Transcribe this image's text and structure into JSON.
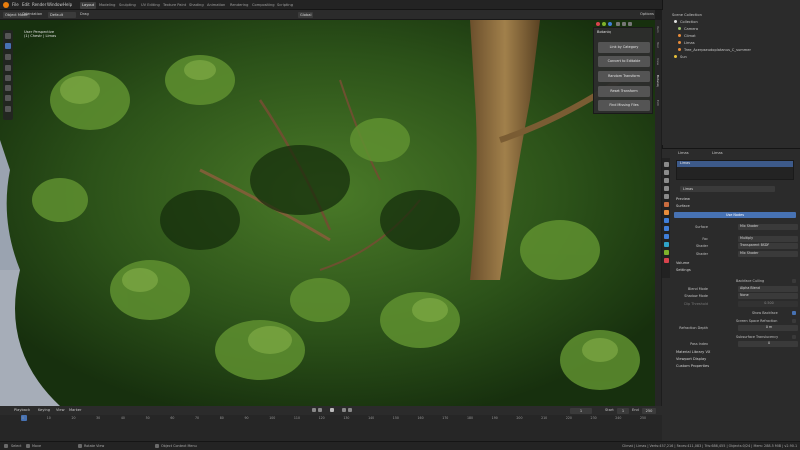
{
  "menu": [
    "File",
    "Edit",
    "Render",
    "Window",
    "Help"
  ],
  "workspaces": [
    "Layout",
    "Modeling",
    "Sculpting",
    "UV Editing",
    "Texture Paint",
    "Shading",
    "Animation",
    "Rendering",
    "Compositing",
    "Scripting"
  ],
  "top_right": {
    "scene": "Scene",
    "view_layer": "View Layer"
  },
  "viewport_header": {
    "mode": "Object Mode",
    "view": "View",
    "select": "Select",
    "add": "Add",
    "object": "Object",
    "transform": "Global",
    "orientation": "Orientation",
    "orientation_value": "Default",
    "drag": "Drag",
    "drag_value": "Select Box",
    "options": "Options"
  },
  "viewport_overlay": {
    "line1": "User Perspective",
    "line2": "(1) Chestr | Limas"
  },
  "npanel": {
    "title": "Botaniq",
    "buttons": [
      "Link by Category",
      "Convert to Editable",
      "Random Transform",
      "Reset Transform",
      "Find Missing Files"
    ]
  },
  "side_tabs": [
    "Item",
    "Tool",
    "View",
    "Botaniq",
    "Edit"
  ],
  "outliner": {
    "header": "Scene Collection",
    "rows": [
      "Collection",
      "Camera",
      "Climat",
      "Limas",
      "Tree_Acerpseudoplatanus_C_summer",
      "Sun"
    ]
  },
  "properties": {
    "object": "Limas",
    "material_tab": "Limas",
    "slot": "Limas",
    "material_name": "Limas",
    "sections": {
      "preview": "Preview",
      "surface": "Surface",
      "volume": "Volume",
      "settings": "Settings",
      "lineart": "Material Library VX",
      "viewport_display": "Viewport Display",
      "custom_props": "Custom Properties"
    },
    "use_nodes": "Use Nodes",
    "surface_rows": [
      {
        "label": "Surface",
        "value": "Mix Shader"
      },
      {
        "label": "Fac",
        "value": "Multiply"
      },
      {
        "label": "Shader",
        "value": "Transparent BSDF"
      },
      {
        "label": "Shader",
        "value": "Mix Shader"
      }
    ],
    "settings_rows": [
      {
        "label": "Backface Culling",
        "value": ""
      },
      {
        "label": "Blend Mode",
        "value": "Alpha Blend"
      },
      {
        "label": "Shadow Mode",
        "value": "None"
      },
      {
        "label": "Clip Threshold",
        "value": "0.500"
      },
      {
        "label": "Show Backface",
        "value": ""
      },
      {
        "label": "Screen Space Refraction",
        "value": ""
      },
      {
        "label": "Refraction Depth",
        "value": "0 m"
      },
      {
        "label": "Subsurface Translucency",
        "value": ""
      },
      {
        "label": "Pass Index",
        "value": "0"
      }
    ]
  },
  "timeline": {
    "playback": "Playback",
    "keying": "Keying",
    "view": "View",
    "marker": "Marker",
    "current": "1",
    "start_label": "Start",
    "start": "1",
    "end_label": "End",
    "end": "250",
    "ticks": [
      "0",
      "10",
      "20",
      "30",
      "40",
      "50",
      "60",
      "70",
      "80",
      "90",
      "100",
      "110",
      "120",
      "130",
      "140",
      "150",
      "160",
      "170",
      "180",
      "190",
      "200",
      "210",
      "220",
      "230",
      "240",
      "250"
    ]
  },
  "status": {
    "select": "Select",
    "move": "Move",
    "rotate": "Rotate View",
    "context": "Object Context Menu",
    "stats": "Climat | Limas | Verts:457,216 | Faces:411,083 | Tris:686,455 | Objects:0/24 | Mem: 288.5 MiB | v2.90.1"
  },
  "colors": {
    "accent": "#4772b3",
    "foliage_dark": "#1f3a14",
    "foliage_mid": "#3d6b22",
    "foliage_light": "#6f9a3a",
    "trunk": "#8a6a3c",
    "sky": "#9aa2ae"
  }
}
